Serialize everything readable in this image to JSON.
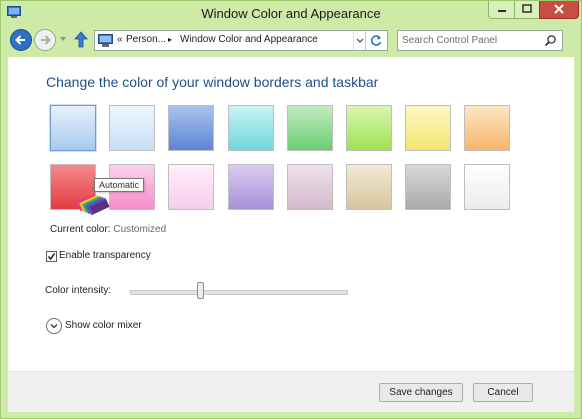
{
  "window": {
    "title": "Window Color and Appearance"
  },
  "address_bar": {
    "chevron": "«",
    "breadcrumbs": [
      "Person...",
      "Window Color and Appearance"
    ],
    "separator": "▸"
  },
  "search": {
    "placeholder": "Search Control Panel"
  },
  "heading": "Change the color of your window borders and taskbar",
  "swatches": [
    {
      "color_top": "#e6f1fb",
      "color_bottom": "#a9c9ee",
      "selected": true,
      "icon": "color-wheel-icon"
    },
    {
      "color_top": "#eef6ff",
      "color_bottom": "#c8def5"
    },
    {
      "color_top": "#a9c2ee",
      "color_bottom": "#5d86d4"
    },
    {
      "color_top": "#c9f3f4",
      "color_bottom": "#6fd7dd"
    },
    {
      "color_top": "#c2ecc1",
      "color_bottom": "#6bcd70"
    },
    {
      "color_top": "#d9f6b1",
      "color_bottom": "#9fe252"
    },
    {
      "color_top": "#fdf7c8",
      "color_bottom": "#f5e56f"
    },
    {
      "color_top": "#fde6c6",
      "color_bottom": "#f7b66a"
    },
    {
      "color_top": "#f58a8d",
      "color_bottom": "#e23b41"
    },
    {
      "color_top": "#fdd2ec",
      "color_bottom": "#f58cca"
    },
    {
      "color_top": "#fff0fb",
      "color_bottom": "#f8cdec"
    },
    {
      "color_top": "#d9ccf0",
      "color_bottom": "#a98fda"
    },
    {
      "color_top": "#efe2ec",
      "color_bottom": "#d3b9cc"
    },
    {
      "color_top": "#f2e9d6",
      "color_bottom": "#d7c59c"
    },
    {
      "color_top": "#d9d9d9",
      "color_bottom": "#a9a9a9"
    },
    {
      "color_top": "#ffffff",
      "color_bottom": "#ececec"
    }
  ],
  "tooltip": "Automatic",
  "current_color": {
    "label": "Current color:",
    "value": "Customized"
  },
  "transparency": {
    "label": "Enable transparency",
    "checked": true
  },
  "intensity": {
    "label": "Color intensity:",
    "value_fraction": 0.33
  },
  "mixer": {
    "label": "Show color mixer"
  },
  "buttons": {
    "save": "Save changes",
    "cancel": "Cancel"
  },
  "colors": {
    "frame": "#cdeaa6",
    "heading": "#1e4f8a",
    "close": "#c94d43"
  }
}
